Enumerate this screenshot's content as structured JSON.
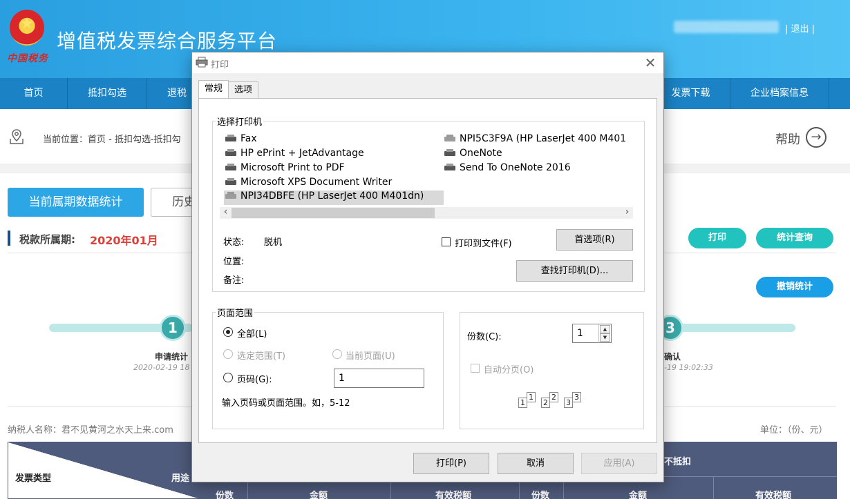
{
  "header": {
    "emblem_text": "中国税务",
    "title": "增值税发票综合服务平台",
    "logout": "| 退出 |"
  },
  "nav": {
    "items": [
      {
        "label": "首页"
      },
      {
        "label": "抵扣勾选"
      },
      {
        "label": "退税勾"
      },
      {
        "label": "发票下载"
      },
      {
        "label": "企业档案信息"
      }
    ]
  },
  "breadcrumb": {
    "text": "当前位置：首页 - 抵扣勾选-抵扣勾",
    "help": "帮助"
  },
  "tabs": {
    "current": "当前属期数据统计",
    "history": "历史"
  },
  "period": {
    "label": "税款所属期:",
    "value": "2020年01月"
  },
  "actions": {
    "print": "打印",
    "stats_query": "统计查询",
    "cancel_stats": "撤销统计"
  },
  "steps": [
    {
      "number": "1",
      "label": "申请统计",
      "time": "2020-02-19 18"
    },
    {
      "number": "3",
      "label": "确认",
      "time": "-19 19:02:33"
    }
  ],
  "info": {
    "taxpayer": "纳税人名称：君不见黄河之水天上来.com",
    "unit": "单位：（份、元）"
  },
  "table": {
    "header_invoice_type": "发票类型",
    "header_usage": "用途",
    "header_not_deductible": "不抵扣",
    "columns": [
      "份数",
      "金额",
      "有效税额",
      "份数",
      "金额",
      "有效税额"
    ]
  },
  "dialog": {
    "title": "打印",
    "tabs": [
      {
        "label": "常规"
      },
      {
        "label": "选项"
      }
    ],
    "select_printer": "选择打印机",
    "printers_left": [
      {
        "name": "Fax"
      },
      {
        "name": "HP ePrint + JetAdvantage"
      },
      {
        "name": "Microsoft Print to PDF"
      },
      {
        "name": "Microsoft XPS Document Writer"
      },
      {
        "name": "NPI34DBFE (HP LaserJet 400 M401dn)"
      }
    ],
    "printers_right": [
      {
        "name": "NPI5C3F9A (HP LaserJet 400 M401"
      },
      {
        "name": "OneNote"
      },
      {
        "name": "Send To OneNote 2016"
      }
    ],
    "status_label": "状态:",
    "status_value": "脱机",
    "location_label": "位置:",
    "comment_label": "备注:",
    "print_to_file": "打印到文件(F)",
    "preferences": "首选项(R)",
    "find_printer": "查找打印机(D)...",
    "page_range": "页面范围",
    "all": "全部(L)",
    "selection": "选定范围(T)",
    "current_page": "当前页面(U)",
    "pages": "页码(G):",
    "pages_value": "1",
    "pages_hint": "输入页码或页面范围。如，5-12",
    "copies_label": "份数(C):",
    "copies_value": "1",
    "collate": "自动分页(O)",
    "collate_pages": [
      "1",
      "1",
      "2",
      "2",
      "3",
      "3"
    ],
    "btn_print": "打印(P)",
    "btn_cancel": "取消",
    "btn_apply": "应用(A)"
  }
}
